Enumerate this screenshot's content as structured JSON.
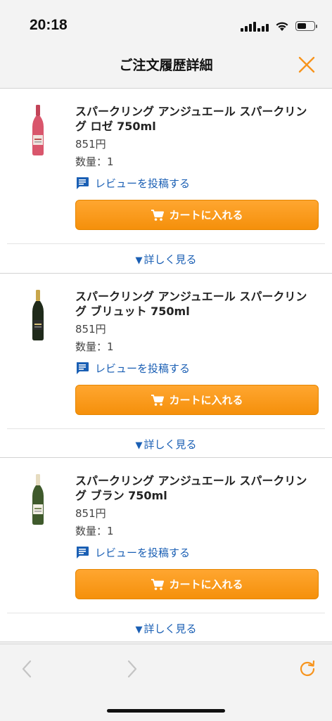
{
  "status": {
    "time": "20:18"
  },
  "header": {
    "title": "ご注文履歴詳細"
  },
  "items": [
    {
      "name": "スパークリング アンジュエール スパークリング ロゼ 750ml",
      "price": "851円",
      "quantity": "数量：1",
      "review_label": "レビューを投稿する",
      "cart_label": "カートに入れる",
      "more_label": "詳しく見る"
    },
    {
      "name": "スパークリング アンジュエール スパークリング ブリュット 750ml",
      "price": "851円",
      "quantity": "数量：1",
      "review_label": "レビューを投稿する",
      "cart_label": "カートに入れる",
      "more_label": "詳しく見る"
    },
    {
      "name": "スパークリング アンジュエール スパークリング ブラン 750ml",
      "price": "851円",
      "quantity": "数量：1",
      "review_label": "レビューを投稿する",
      "cart_label": "カートに入れる",
      "more_label": "詳しく見る"
    }
  ],
  "colors": {
    "accent_orange": "#f7941d",
    "link_blue": "#1a5fb4",
    "rose_bottle": "#d9566c",
    "brut_bottle": "#1f2a1a",
    "blanc_bottle": "#3f5a2c"
  },
  "icons": {
    "close": "close-icon",
    "review": "comment-icon",
    "cart": "cart-icon",
    "back": "chevron-left-icon",
    "forward": "chevron-right-icon",
    "reload": "reload-icon"
  }
}
